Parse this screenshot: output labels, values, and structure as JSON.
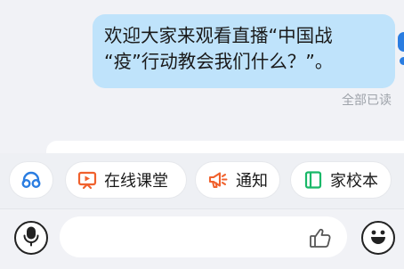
{
  "message": {
    "lines": [
      "欢迎大家来观看直播“中国战",
      "“疫”行动教会我们什么？”。"
    ],
    "read_status": "全部已读"
  },
  "quick_actions": {
    "support_icon": "headset-icon",
    "online_class": "在线课堂",
    "notice": "通知",
    "home_school_book": "家校本"
  },
  "input_bar": {
    "placeholder": "",
    "left_icon": "microphone-icon",
    "right_icon": "emoji-icon",
    "inline_icon": "thumbs-up-icon"
  },
  "colors": {
    "bubble": "#bfe3fb",
    "accent_orange": "#f0612d",
    "accent_green": "#19b868",
    "accent_blue": "#2a7de1"
  }
}
